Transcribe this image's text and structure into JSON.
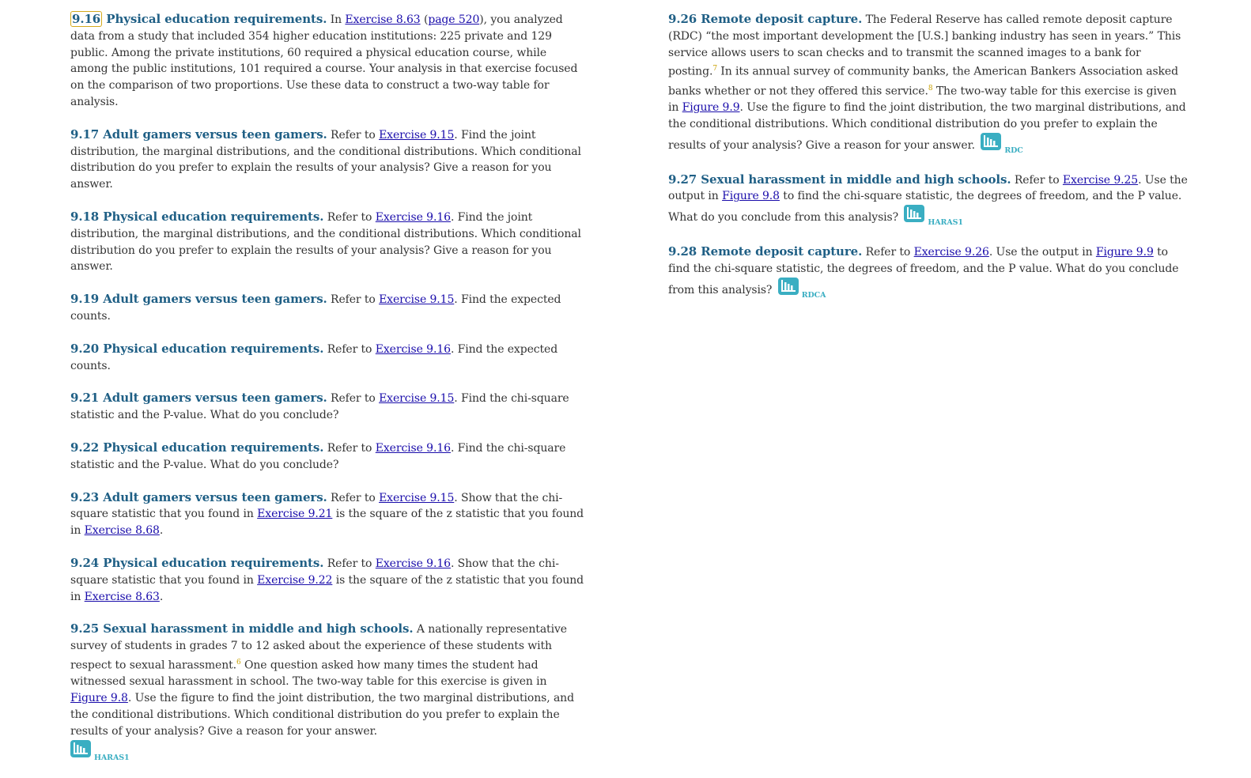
{
  "left": [
    {
      "num": "9.16",
      "title": "Physical education requirements.",
      "parts": [
        {
          "t": " In "
        },
        {
          "l": "Exercise 8.63"
        },
        {
          "t": " ("
        },
        {
          "l": "page 520"
        },
        {
          "t": "), you analyzed data from a study that included 354 higher education institutions: 225 private and 129 public. Among the private institutions, 60 required a physical education course, while among the public institutions, 101 required a course. Your analysis in that exercise focused on the comparison of two proportions. Use these data to construct a two-way table for analysis."
        }
      ]
    },
    {
      "num": "9.17",
      "title": "Adult gamers versus teen gamers.",
      "parts": [
        {
          "t": " Refer to "
        },
        {
          "l": "Exercise 9.15"
        },
        {
          "t": ". Find the joint distribution, the marginal distributions, and the conditional distributions. Which conditional distribution do you prefer to explain the results of your analysis? Give a reason for you answer."
        }
      ]
    },
    {
      "num": "9.18",
      "title": "Physical education requirements.",
      "parts": [
        {
          "t": " Refer to "
        },
        {
          "l": "Exercise 9.16"
        },
        {
          "t": ". Find the joint distribution, the marginal distributions, and the conditional distributions. Which conditional distribution do you prefer to explain the results of your analysis? Give a reason for you answer."
        }
      ]
    },
    {
      "num": "9.19",
      "title": "Adult gamers versus teen gamers.",
      "parts": [
        {
          "t": " Refer to "
        },
        {
          "l": "Exercise 9.15"
        },
        {
          "t": ". Find the expected counts."
        }
      ]
    },
    {
      "num": "9.20",
      "title": "Physical education requirements.",
      "parts": [
        {
          "t": " Refer to "
        },
        {
          "l": "Exercise 9.16"
        },
        {
          "t": ". Find the expected counts."
        }
      ]
    },
    {
      "num": "9.21",
      "title": "Adult gamers versus teen gamers.",
      "parts": [
        {
          "t": " Refer to "
        },
        {
          "l": "Exercise 9.15"
        },
        {
          "t": ". Find the chi-square statistic and the P-value. What do you conclude?"
        }
      ]
    },
    {
      "num": "9.22",
      "title": "Physical education requirements.",
      "parts": [
        {
          "t": " Refer to "
        },
        {
          "l": "Exercise 9.16"
        },
        {
          "t": ". Find the chi-square statistic and the P-value. What do you conclude?"
        }
      ]
    },
    {
      "num": "9.23",
      "title": "Adult gamers versus teen gamers.",
      "parts": [
        {
          "t": " Refer to "
        },
        {
          "l": "Exercise 9.15"
        },
        {
          "t": ". Show that the chi-square statistic that you found in "
        },
        {
          "l": "Exercise 9.21"
        },
        {
          "t": " is the square of the z statistic that you found in "
        },
        {
          "l": "Exercise 8.68"
        },
        {
          "t": "."
        }
      ]
    },
    {
      "num": "9.24",
      "title": "Physical education requirements.",
      "parts": [
        {
          "t": " Refer to "
        },
        {
          "l": "Exercise 9.16"
        },
        {
          "t": ". Show that the chi-square statistic that you found in "
        },
        {
          "l": "Exercise 9.22"
        },
        {
          "t": " is the square of the z statistic that you found in "
        },
        {
          "l": "Exercise 8.63"
        },
        {
          "t": "."
        }
      ]
    },
    {
      "num": "9.25",
      "title": "Sexual harassment in middle and high schools.",
      "parts": [
        {
          "t": " A nationally representative survey of students in grades 7 to 12 asked about the experience of these students with respect to sexual harassment."
        },
        {
          "s": "6"
        },
        {
          "t": " One question asked how many times the student had witnessed sexual harassment in school. The two-way table for this exercise is given in "
        },
        {
          "l": "Figure 9.8"
        },
        {
          "t": ". Use the figure to find the joint distribution, the two marginal distributions, and the conditional distributions. Which conditional distribution do you prefer to explain the results of your analysis? Give a reason for your answer."
        },
        {
          "br": true
        },
        {
          "icon": "HARAS1"
        }
      ]
    }
  ],
  "right": [
    {
      "num": "9.26",
      "title": "Remote deposit capture.",
      "parts": [
        {
          "t": " The Federal Reserve has called remote deposit capture (RDC) “the most important development the [U.S.] banking industry has seen in years.” This service allows users to scan checks and to transmit the scanned images to a bank for posting."
        },
        {
          "s": "7"
        },
        {
          "t": " In its annual survey of community banks, the American Bankers Association asked banks whether or not they offered this service."
        },
        {
          "s": "8"
        },
        {
          "t": " The two-way table for this exercise is given in "
        },
        {
          "l": "Figure 9.9"
        },
        {
          "t": ". Use the figure to find the joint distribution, the two marginal distributions, and the conditional distributions. Which conditional distribution do you prefer to explain the results of your analysis? Give a reason for your answer. "
        },
        {
          "icon": "RDC"
        }
      ]
    },
    {
      "num": "9.27",
      "title": "Sexual harassment in middle and high schools.",
      "parts": [
        {
          "t": " Refer to "
        },
        {
          "l": "Exercise 9.25"
        },
        {
          "t": ". Use the output in "
        },
        {
          "l": "Figure 9.8"
        },
        {
          "t": " to find the chi-square statistic, the degrees of freedom, and the P value. What do you conclude from this analysis? "
        },
        {
          "icon": "HARAS1"
        }
      ]
    },
    {
      "num": "9.28",
      "title": "Remote deposit capture.",
      "parts": [
        {
          "t": " Refer to "
        },
        {
          "l": "Exercise 9.26"
        },
        {
          "t": ". Use the output in "
        },
        {
          "l": "Figure 9.9"
        },
        {
          "t": " to find the chi-square statistic, the degrees of freedom, and the P value. What do you conclude from this analysis? "
        },
        {
          "icon": "RDCA"
        }
      ]
    }
  ],
  "icon_name": "data-file-icon",
  "colors": {
    "title": "#1f5f85",
    "link": "#1a0dab",
    "icon": "#3aaec2",
    "highlight": "#d4aa1c"
  }
}
